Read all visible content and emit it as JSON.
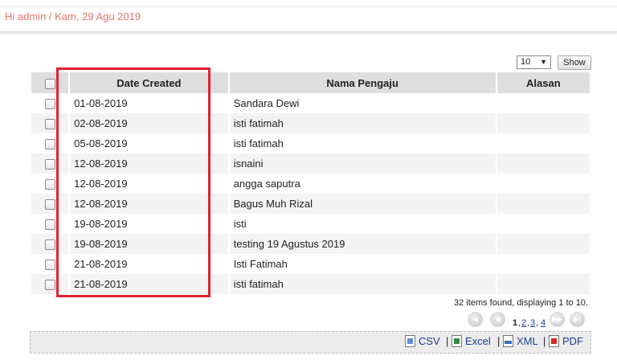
{
  "header": {
    "greeting": "Hi admin / Kam, 29 Agu 2019"
  },
  "controls": {
    "page_size": "10",
    "show_label": "Show"
  },
  "table": {
    "columns": [
      "Date Created",
      "Nama Pengaju",
      "Alasan"
    ],
    "rows": [
      {
        "date": "01-08-2019",
        "nama": "Sandara Dewi",
        "alasan": ""
      },
      {
        "date": "02-08-2019",
        "nama": "isti fatimah",
        "alasan": ""
      },
      {
        "date": "05-08-2019",
        "nama": "isti fatimah",
        "alasan": ""
      },
      {
        "date": "12-08-2019",
        "nama": "isnaini",
        "alasan": ""
      },
      {
        "date": "12-08-2019",
        "nama": "angga saputra",
        "alasan": ""
      },
      {
        "date": "12-08-2019",
        "nama": "Bagus Muh Rizal",
        "alasan": ""
      },
      {
        "date": "19-08-2019",
        "nama": "isti",
        "alasan": ""
      },
      {
        "date": "19-08-2019",
        "nama": "testing 19 Agustus 2019",
        "alasan": ""
      },
      {
        "date": "21-08-2019",
        "nama": "Isti Fatimah",
        "alasan": ""
      },
      {
        "date": "21-08-2019",
        "nama": "isti fatimah",
        "alasan": ""
      }
    ]
  },
  "pagination": {
    "summary": "32 items found, displaying 1 to 10.",
    "pages": [
      "1",
      "2",
      "3",
      "4"
    ],
    "current_page": "1"
  },
  "export": {
    "csv": "CSV",
    "excel": "Excel",
    "xml": "XML",
    "pdf": "PDF",
    "separator": "|"
  },
  "colors": {
    "greeting": "#e2776e",
    "highlight": "#e3222c",
    "link": "#1a3d99"
  }
}
